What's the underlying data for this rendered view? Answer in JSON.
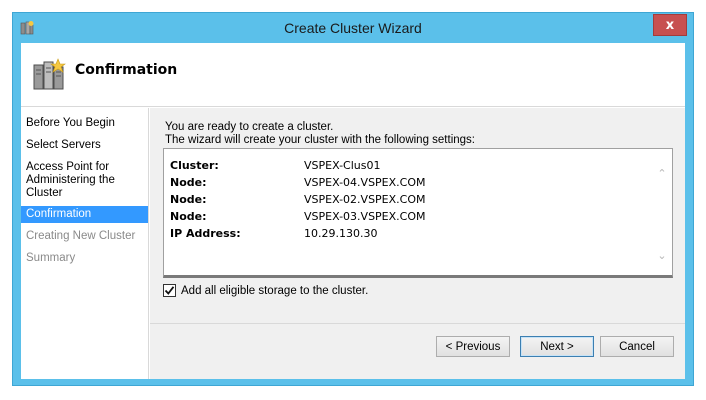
{
  "window": {
    "title": "Create Cluster Wizard",
    "close_label": "x"
  },
  "header": {
    "title": "Confirmation"
  },
  "nav": {
    "items": [
      {
        "label": "Before You Begin",
        "state": "normal"
      },
      {
        "label": "Select Servers",
        "state": "normal"
      },
      {
        "label": "Access Point for Administering the Cluster",
        "state": "normal"
      },
      {
        "label": "Confirmation",
        "state": "active"
      },
      {
        "label": "Creating New Cluster",
        "state": "dim"
      },
      {
        "label": "Summary",
        "state": "dim"
      }
    ]
  },
  "content": {
    "intro_line1": "You are ready to create a cluster.",
    "intro_line2": "The wizard will create your cluster with the following settings:",
    "settings": [
      {
        "key": "Cluster:",
        "value": "VSPEX-Clus01"
      },
      {
        "key": "Node:",
        "value": "VSPEX-04.VSPEX.COM"
      },
      {
        "key": "Node:",
        "value": "VSPEX-02.VSPEX.COM"
      },
      {
        "key": "Node:",
        "value": "VSPEX-03.VSPEX.COM"
      },
      {
        "key": "IP Address:",
        "value": "10.29.130.30"
      }
    ],
    "storage_checkbox_label": "Add all eligible storage to the cluster.",
    "storage_checked": true
  },
  "footer": {
    "previous_label": "< Previous",
    "next_label": "Next >",
    "cancel_label": "Cancel"
  },
  "colors": {
    "frame": "#5bc0ea",
    "active_nav": "#3399ff",
    "close": "#c75050"
  }
}
